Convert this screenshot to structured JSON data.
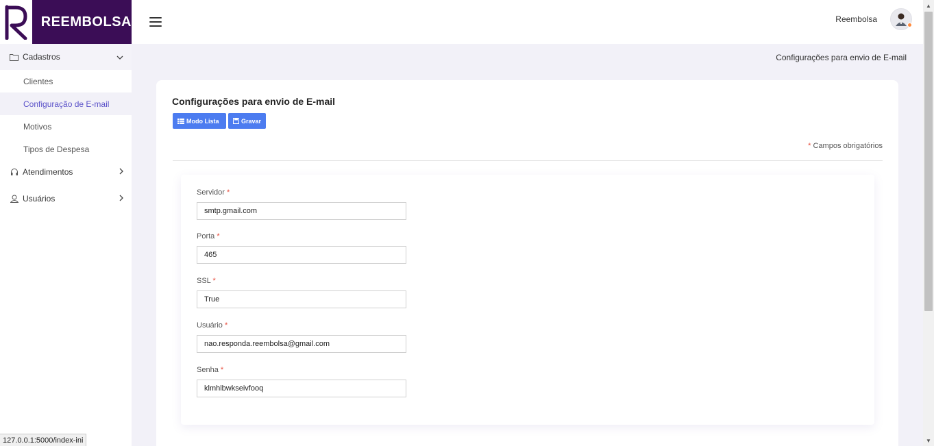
{
  "brand": {
    "name": "REEMBOLSA",
    "logo_letter": "R",
    "color": "#3b0d56"
  },
  "sidebar": {
    "groups": [
      {
        "label": "Cadastros",
        "icon": "folder-icon",
        "expanded": true,
        "items": [
          "Clientes",
          "Configuração de E-mail",
          "Motivos",
          "Tipos de Despesa"
        ],
        "active_item": "Configuração de E-mail"
      },
      {
        "label": "Atendimentos",
        "icon": "headphones-icon",
        "expanded": false
      },
      {
        "label": "Usuários",
        "icon": "user-icon",
        "expanded": false
      }
    ]
  },
  "topbar": {
    "user_name": "Reembolsa",
    "avatar": "avatar-icon"
  },
  "breadcrumb": "Configurações para envio de E-mail",
  "card": {
    "title": "Configurações para envio de E-mail",
    "buttons": {
      "list_label": "Modo Lista",
      "save_label": "Gravar"
    },
    "required_note": "Campos obrigatórios",
    "required_mark": "*"
  },
  "form": {
    "fields": [
      {
        "label": "Servidor",
        "value": "smtp.gmail.com"
      },
      {
        "label": "Porta",
        "value": "465"
      },
      {
        "label": "SSL",
        "value": "True"
      },
      {
        "label": "Usuário",
        "value": "nao.responda.reembolsa@gmail.com"
      },
      {
        "label": "Senha",
        "value": "klmhlbwkseivfooq"
      }
    ]
  },
  "status_url": "127.0.0.1:5000/index-ini",
  "colors": {
    "accent": "#4c7cf0",
    "active_text": "#5b52c9",
    "required": "#e74c3c"
  }
}
